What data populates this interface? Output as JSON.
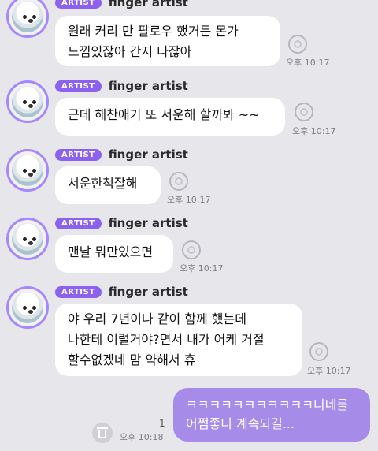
{
  "badge": "ARTIST",
  "sender": "finger artist",
  "messages": [
    {
      "text": "원래 커리 만 팔로우 했거든 몬가\n느낌있잖아 간지 나잖아",
      "time": "오후 10:17"
    },
    {
      "text": "근데 해찬애기 또 서운해 할까봐 ~~",
      "time": "오후 10:17"
    },
    {
      "text": "서운한척잘해",
      "time": "오후 10:17"
    },
    {
      "text": "맨날 뭐만있으면",
      "time": "오후 10:17"
    },
    {
      "text": "야 우리 7년이나 같이 함께 했는데\n나한테 이럴거야?면서 내가 어케 거절\n할수없겠네 맘 약해서 휴",
      "time": "오후 10:17"
    }
  ],
  "my_message": {
    "text": "ㅋㅋㅋㅋㅋㅋㅋㅋㅋㅋㅋ니네를\n어쩜좋니 계속되길...",
    "time": "오후 10:18",
    "unread": "1"
  }
}
